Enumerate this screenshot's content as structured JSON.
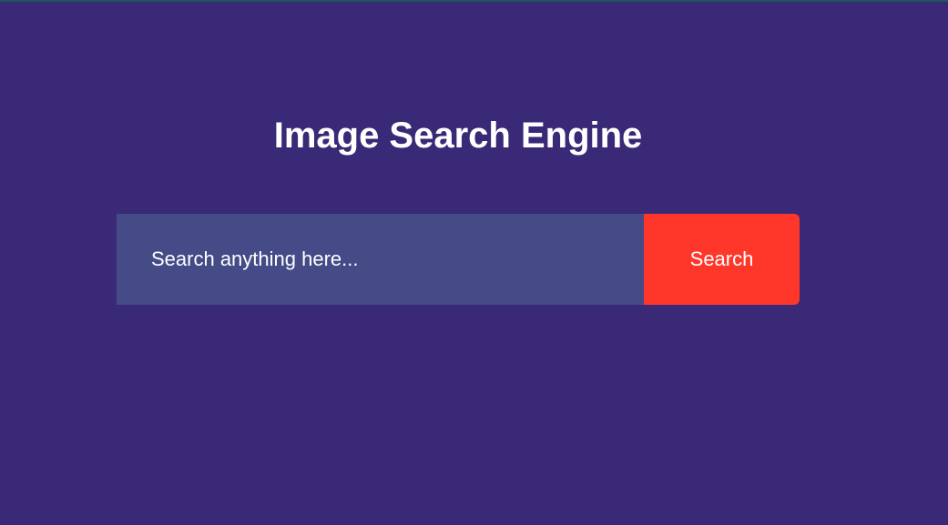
{
  "header": {
    "title": "Image Search Engine"
  },
  "search": {
    "placeholder": "Search anything here...",
    "value": "",
    "button_label": "Search"
  },
  "colors": {
    "background": "#3a2977",
    "input_background": "#444b87",
    "button_background": "#ff372b",
    "text": "#ffffff",
    "top_strip": "#1f5560"
  }
}
